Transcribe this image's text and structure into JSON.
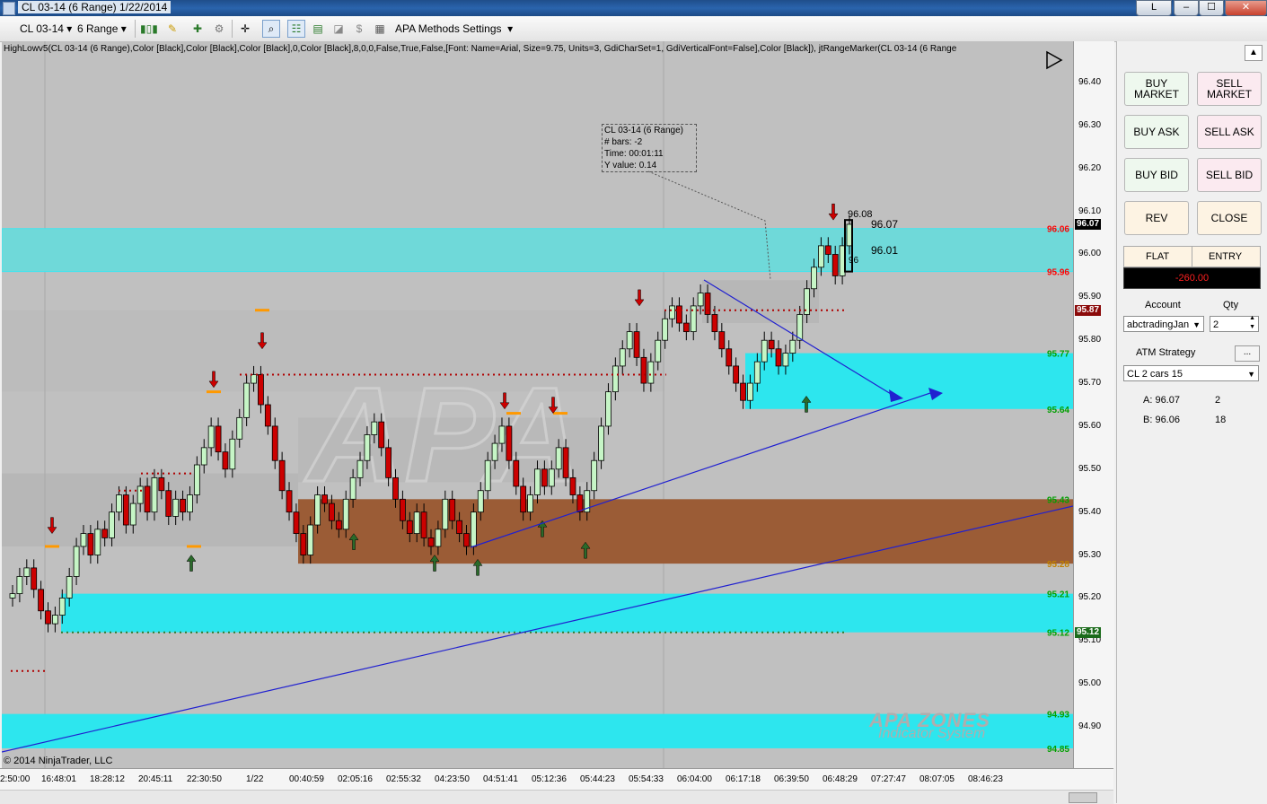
{
  "window": {
    "title": "CL 03-14 (6 Range)  1/22/2014",
    "buttons": [
      "L",
      "–",
      "☐",
      "✕"
    ]
  },
  "toolbar": {
    "instrument": "CL 03-14",
    "period": "6 Range",
    "apa_label": "APA Methods Settings",
    "icons": [
      "candlestick-icon",
      "pencil-icon",
      "add-indicator-icon",
      "strategy-icon",
      "crosshair-icon",
      "zoom-icon",
      "properties-icon",
      "data-box-icon",
      "chart-trader-icon",
      "dollar-icon",
      "template-icon"
    ]
  },
  "chart": {
    "indicator_line": "HighLowv5(CL 03-14 (6 Range),Color [Black],Color [Black],Color [Black],0,Color [Black],8,0,0,False,True,False,[Font: Name=Arial, Size=9.75, Units=3, GdiCharSet=1, GdiVerticalFont=False],Color [Black]), jtRangeMarker(CL 03-14 (6 Range",
    "copyright": "© 2014 NinjaTrader, LLC",
    "watermark_logo": "APA ZONES",
    "watermark_sub": "Indicator System",
    "tooltip": {
      "line1": "CL 03-14 (6 Range)",
      "line2": "# bars:   -2",
      "line3": "Time:     00:01:11",
      "line4": "Y value: 0.14"
    },
    "annotations": {
      "a1": "96.08",
      "a2": "96.07",
      "a3": "96.01",
      "a4": "96"
    },
    "zone_labels": [
      {
        "text": "96.06",
        "color": "#ff0000",
        "price": 96.06
      },
      {
        "text": "95.96",
        "color": "#ff0000",
        "price": 95.96
      },
      {
        "text": "95.77",
        "color": "#00a000",
        "price": 95.77
      },
      {
        "text": "95.64",
        "color": "#00a000",
        "price": 95.64
      },
      {
        "text": "95.43",
        "color": "#00a000",
        "price": 95.43
      },
      {
        "text": "95.28",
        "color": "#c08000",
        "price": 95.28
      },
      {
        "text": "95.21",
        "color": "#00a000",
        "price": 95.21
      },
      {
        "text": "95.12",
        "color": "#00a000",
        "price": 95.12
      },
      {
        "text": "94.93",
        "color": "#00a000",
        "price": 94.93
      },
      {
        "text": "94.85",
        "color": "#00a000",
        "price": 94.85
      }
    ],
    "zones": [
      {
        "from": 95.96,
        "to": 96.06,
        "color": "#6fd9d9",
        "x0": 0,
        "x1": 1193
      },
      {
        "from": 95.64,
        "to": 95.77,
        "color": "#2de6ee",
        "x0": 828,
        "x1": 1193
      },
      {
        "from": 95.28,
        "to": 95.43,
        "color": "#9b5c36",
        "x0": 330,
        "x1": 1193
      },
      {
        "from": 95.12,
        "to": 95.21,
        "color": "#2de6ee",
        "x0": 66,
        "x1": 1193
      },
      {
        "from": 94.85,
        "to": 94.93,
        "color": "#2de6ee",
        "x0": 0,
        "x1": 1193
      }
    ]
  },
  "chart_data": {
    "type": "candlestick",
    "title": "CL 03-14 (6 Range)",
    "ylim": [
      94.83,
      96.5
    ],
    "y_ticks": [
      "96.40",
      "96.30",
      "96.20",
      "96.10",
      "96.00",
      "95.90",
      "95.80",
      "95.70",
      "95.60",
      "95.50",
      "95.40",
      "95.30",
      "95.20",
      "95.10",
      "95.00",
      "94.90"
    ],
    "x_ticks": [
      "2:50:00",
      "16:48:01",
      "18:28:12",
      "20:45:11",
      "22:30:50",
      "1/22",
      "00:40:59",
      "02:05:16",
      "02:55:32",
      "04:23:50",
      "04:51:41",
      "05:12:36",
      "05:44:23",
      "05:54:33",
      "06:04:00",
      "06:17:18",
      "06:39:50",
      "06:48:29",
      "07:27:47",
      "08:07:05",
      "08:46:23"
    ],
    "last_price": "96.07",
    "marker_87": "95.87",
    "marker_12": "95.12",
    "closes": [
      95.21,
      95.25,
      95.27,
      95.22,
      95.17,
      95.14,
      95.16,
      95.2,
      95.25,
      95.32,
      95.35,
      95.3,
      95.36,
      95.34,
      95.4,
      95.44,
      95.37,
      95.42,
      95.46,
      95.4,
      95.48,
      95.45,
      95.39,
      95.43,
      95.4,
      95.44,
      95.51,
      95.55,
      95.6,
      95.54,
      95.5,
      95.57,
      95.62,
      95.7,
      95.72,
      95.65,
      95.6,
      95.52,
      95.45,
      95.4,
      95.35,
      95.3,
      95.37,
      95.44,
      95.42,
      95.38,
      95.36,
      95.43,
      95.48,
      95.52,
      95.58,
      95.61,
      95.55,
      95.48,
      95.43,
      95.38,
      95.35,
      95.4,
      95.34,
      95.32,
      95.36,
      95.43,
      95.38,
      95.35,
      95.32,
      95.4,
      95.45,
      95.52,
      95.56,
      95.6,
      95.52,
      95.46,
      95.4,
      95.44,
      95.5,
      95.46,
      95.5,
      95.55,
      95.48,
      95.44,
      95.4,
      95.45,
      95.52,
      95.6,
      95.68,
      95.74,
      95.78,
      95.82,
      95.76,
      95.7,
      95.75,
      95.8,
      95.85,
      95.88,
      95.84,
      95.82,
      95.88,
      95.91,
      95.86,
      95.82,
      95.78,
      95.74,
      95.7,
      95.66,
      95.7,
      95.75,
      95.8,
      95.78,
      95.74,
      95.77,
      95.8,
      95.86,
      95.92,
      95.97,
      96.02,
      96.0,
      95.95,
      96.02,
      96.07
    ]
  },
  "panel": {
    "buttons": {
      "buy_market": "BUY\nMARKET",
      "sell_market": "SELL\nMARKET",
      "buy_ask": "BUY ASK",
      "sell_ask": "SELL ASK",
      "buy_bid": "BUY BID",
      "sell_bid": "SELL BID",
      "rev": "REV",
      "close": "CLOSE"
    },
    "flat": "FLAT",
    "entry": "ENTRY",
    "pnl": "-260.00",
    "account_label": "Account",
    "qty_label": "Qty",
    "account_value": "abctradingJan",
    "qty_value": "2",
    "atm_label": "ATM Strategy",
    "atm_button": "...",
    "atm_value": "CL 2 cars 15",
    "ask_label": "A: 96.07",
    "ask_size": "2",
    "bid_label": "B: 96.06",
    "bid_size": "18"
  }
}
